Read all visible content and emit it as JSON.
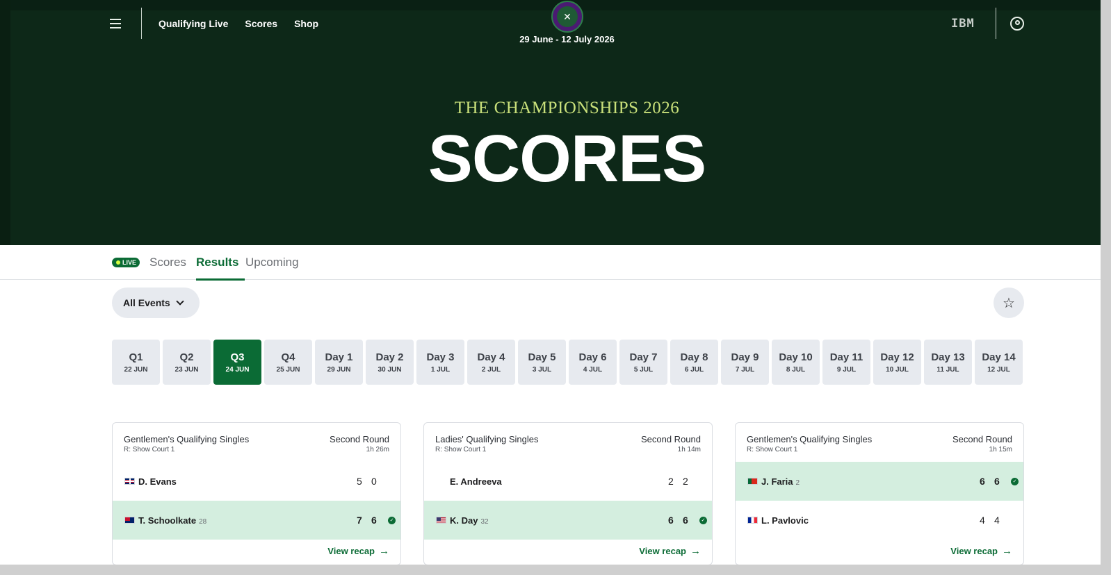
{
  "header": {
    "nav_links": [
      "Qualifying Live",
      "Scores",
      "Shop"
    ],
    "dates": "29 June - 12 July 2026",
    "sponsor": "IBM",
    "subtitle": "THE CHAMPIONSHIPS 2026",
    "title": "SCORES"
  },
  "tabs": {
    "live_badge": "LIVE",
    "items": [
      "Scores",
      "Results",
      "Upcoming"
    ],
    "active": "Results"
  },
  "controls": {
    "events_select": "All Events"
  },
  "days": [
    {
      "label": "Q1",
      "date": "22 JUN"
    },
    {
      "label": "Q2",
      "date": "23 JUN"
    },
    {
      "label": "Q3",
      "date": "24 JUN"
    },
    {
      "label": "Q4",
      "date": "25 JUN"
    },
    {
      "label": "Day 1",
      "date": "29 JUN"
    },
    {
      "label": "Day 2",
      "date": "30 JUN"
    },
    {
      "label": "Day 3",
      "date": "1 JUL"
    },
    {
      "label": "Day 4",
      "date": "2 JUL"
    },
    {
      "label": "Day 5",
      "date": "3 JUL"
    },
    {
      "label": "Day 6",
      "date": "4 JUL"
    },
    {
      "label": "Day 7",
      "date": "5 JUL"
    },
    {
      "label": "Day 8",
      "date": "6 JUL"
    },
    {
      "label": "Day 9",
      "date": "7 JUL"
    },
    {
      "label": "Day 10",
      "date": "8 JUL"
    },
    {
      "label": "Day 11",
      "date": "9 JUL"
    },
    {
      "label": "Day 12",
      "date": "10 JUL"
    },
    {
      "label": "Day 13",
      "date": "11 JUL"
    },
    {
      "label": "Day 14",
      "date": "12 JUL"
    }
  ],
  "active_day": "Q3",
  "matches": [
    {
      "event": "Gentlemen's Qualifying Singles",
      "court": "R: Show Court 1",
      "round": "Second Round",
      "duration": "1h 26m",
      "players": [
        {
          "name": "D. Evans",
          "seed": "",
          "flag": "gb",
          "scores": [
            "5",
            "0"
          ],
          "winner": false
        },
        {
          "name": "T. Schoolkate",
          "seed": "28",
          "flag": "au",
          "scores": [
            "7",
            "6"
          ],
          "winner": true
        }
      ],
      "recap": "View recap"
    },
    {
      "event": "Ladies' Qualifying Singles",
      "court": "R: Show Court 1",
      "round": "Second Round",
      "duration": "1h 14m",
      "players": [
        {
          "name": "E. Andreeva",
          "seed": "",
          "flag": "",
          "scores": [
            "2",
            "2"
          ],
          "winner": false
        },
        {
          "name": "K. Day",
          "seed": "32",
          "flag": "us",
          "scores": [
            "6",
            "6"
          ],
          "winner": true
        }
      ],
      "recap": "View recap"
    },
    {
      "event": "Gentlemen's Qualifying Singles",
      "court": "R: Show Court 1",
      "round": "Second Round",
      "duration": "1h 15m",
      "players": [
        {
          "name": "J. Faria",
          "seed": "2",
          "flag": "pt",
          "scores": [
            "6",
            "6"
          ],
          "winner": true
        },
        {
          "name": "L. Pavlovic",
          "seed": "",
          "flag": "fr",
          "scores": [
            "4",
            "4"
          ],
          "winner": false
        }
      ],
      "recap": "View recap"
    }
  ],
  "colors": {
    "hero_bg": "#0d2818",
    "accent_green": "#0b6b35",
    "subtitle_lime": "#c9e07a",
    "winner_row": "#d4eedf"
  }
}
